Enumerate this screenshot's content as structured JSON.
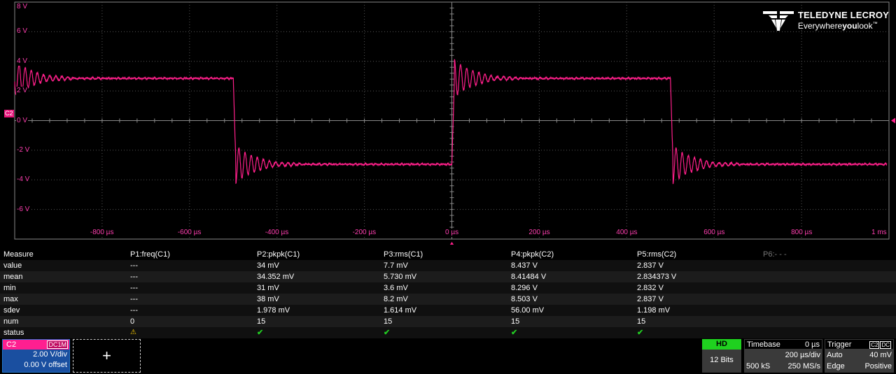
{
  "scope": {
    "volt_labels": [
      "8 V",
      "6 V",
      "4 V",
      "2 V",
      "0 V",
      "-2 V",
      "-4 V",
      "-6 V"
    ],
    "time_labels": [
      "-800 µs",
      "-600 µs",
      "-400 µs",
      "-200 µs",
      "0 µs",
      "200 µs",
      "400 µs",
      "600 µs",
      "800 µs",
      "1 ms"
    ],
    "channel_marker": "C2",
    "trace_color": "#ff1f8a",
    "logo_brand": "TELEDYNE LECROY",
    "logo_tag_pre": "Everywhere",
    "logo_tag_bold": "you",
    "logo_tag_post": "look",
    "logo_tm": "™"
  },
  "measure": {
    "headers": [
      "Measure",
      "P1:freq(C1)",
      "P2:pkpk(C1)",
      "P3:rms(C1)",
      "P4:pkpk(C2)",
      "P5:rms(C2)",
      "P6:- - -"
    ],
    "rows": [
      [
        "value",
        "---",
        "34 mV",
        "7.7 mV",
        "8.437 V",
        "2.837 V"
      ],
      [
        "mean",
        "---",
        "34.352 mV",
        "5.730 mV",
        "8.41484 V",
        "2.834373 V"
      ],
      [
        "min",
        "---",
        "31 mV",
        "3.6 mV",
        "8.296 V",
        "2.832 V"
      ],
      [
        "max",
        "---",
        "38 mV",
        "8.2 mV",
        "8.503 V",
        "2.837 V"
      ],
      [
        "sdev",
        "---",
        "1.978 mV",
        "1.614 mV",
        "56.00 mV",
        "1.198 mV"
      ],
      [
        "num",
        "0",
        "15",
        "15",
        "15",
        "15"
      ]
    ],
    "status_label": "status",
    "status_warn": "⚠",
    "status_ok": "✔"
  },
  "channel": {
    "name": "C2",
    "coupling": "DC1M",
    "vdiv": "2.00 V/div",
    "offset": "0.00 V offset"
  },
  "add_label": "+",
  "hd": {
    "label": "HD",
    "bits": "12 Bits"
  },
  "timebase": {
    "label": "Timebase",
    "delay": "0 µs",
    "tdiv": "200 µs/div",
    "samples": "500 kS",
    "rate": "250 MS/s"
  },
  "trigger": {
    "label": "Trigger",
    "source": "C2",
    "coupling": "DC",
    "mode": "Auto",
    "level": "40 mV",
    "type": "Edge",
    "slope": "Positive"
  }
}
